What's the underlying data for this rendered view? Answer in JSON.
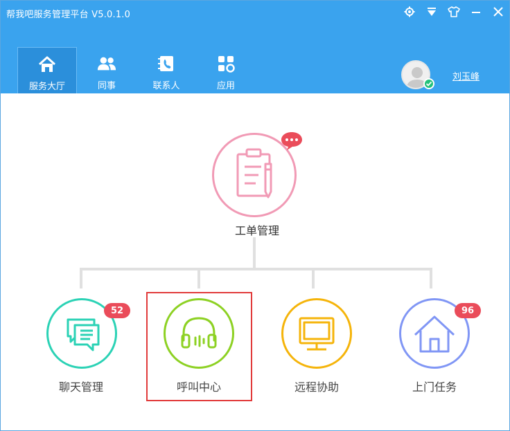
{
  "app": {
    "title": "帮我吧服务管理平台 V5.0.1.0"
  },
  "window_controls": [
    "gear-icon",
    "dropdown-icon",
    "shirt-icon",
    "minimize-icon",
    "close-icon"
  ],
  "nav": {
    "items": [
      {
        "label": "服务大厅",
        "icon": "home-icon",
        "active": true
      },
      {
        "label": "同事",
        "icon": "colleagues-icon",
        "active": false
      },
      {
        "label": "联系人",
        "icon": "contacts-icon",
        "active": false
      },
      {
        "label": "应用",
        "icon": "apps-icon",
        "active": false
      }
    ]
  },
  "user": {
    "name": "刘玉峰",
    "status": "online"
  },
  "hub": {
    "label": "工单管理",
    "icon": "clipboard-icon",
    "notice_icon": "chat-bubble-icon",
    "color": "#f19ab5"
  },
  "modules": [
    {
      "label": "聊天管理",
      "icon": "chat-icon",
      "color": "#2bd2b5",
      "badge": "52"
    },
    {
      "label": "呼叫中心",
      "icon": "headset-icon",
      "color": "#8dd123",
      "badge": ""
    },
    {
      "label": "远程协助",
      "icon": "monitor-icon",
      "color": "#f5b40a",
      "badge": ""
    },
    {
      "label": "上门任务",
      "icon": "house-icon",
      "color": "#8096f5",
      "badge": "96"
    }
  ],
  "colors": {
    "titlebar": "#3aa3ee",
    "badge": "#ea4c5a",
    "highlight": "#e13a3a"
  }
}
